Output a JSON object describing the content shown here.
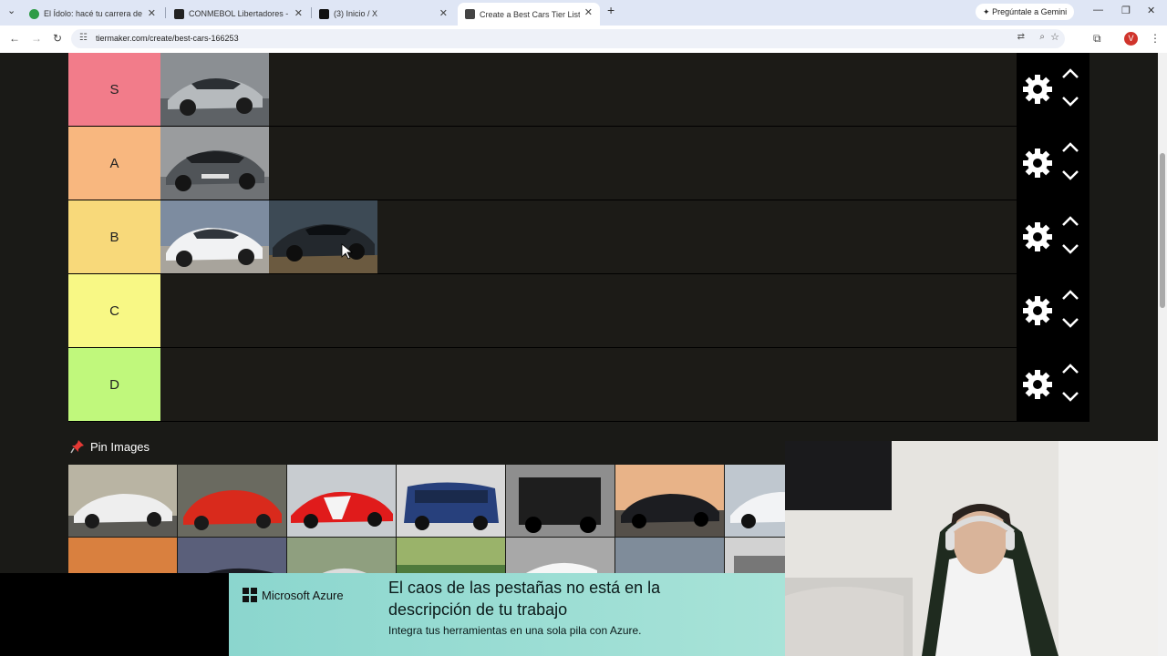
{
  "browser": {
    "tabs": [
      {
        "title": "El Ídolo: hacé tu carrera de fútbol",
        "color": "#2e9b46"
      },
      {
        "title": "CONMEBOL Libertadores - Tabla",
        "color": "#222222"
      },
      {
        "title": "(3) Inicio / X",
        "color": "#111111"
      },
      {
        "title": "Create a Best Cars Tier List - TierMaker",
        "color": "#444444"
      }
    ],
    "gemini_label": "Pregúntale a Gemini",
    "url": "tiermaker.com/create/best-cars-166253",
    "profile_initial": "V"
  },
  "tiers": [
    {
      "label": "S",
      "color": "#f27c8a",
      "items": [
        "audi-r8-silver"
      ]
    },
    {
      "label": "A",
      "color": "#f8b77f",
      "items": [
        "porsche-911-gt2rs-grey"
      ]
    },
    {
      "label": "B",
      "color": "#f8d97a",
      "items": [
        "bmw-m2-white",
        "chevrolet-camaro-black"
      ]
    },
    {
      "label": "C",
      "color": "#f8f885",
      "items": []
    },
    {
      "label": "D",
      "color": "#c0f87c",
      "items": []
    }
  ],
  "pin_images": {
    "label": "Pin Images",
    "row1": [
      "corvette-white",
      "bmw-m3-e30-red",
      "ferrari-488-pista-red",
      "fiat-multipla-blue",
      "mercedes-g-class-black",
      "nissan-skyline-r32-black",
      "nissan-gtr-white"
    ],
    "row2": [
      "sunset-sports-car",
      "dark-supercar",
      "silver-coupe-field",
      "green-field-car",
      "white-sports-car",
      "blue-coupe",
      "grey-sedan"
    ]
  },
  "ad": {
    "brand": "Microsoft Azure",
    "headline": "El caos de las pestañas no está en la descripción de tu trabajo",
    "body": "Integra tus herramientas en una sola pila con Azure."
  }
}
